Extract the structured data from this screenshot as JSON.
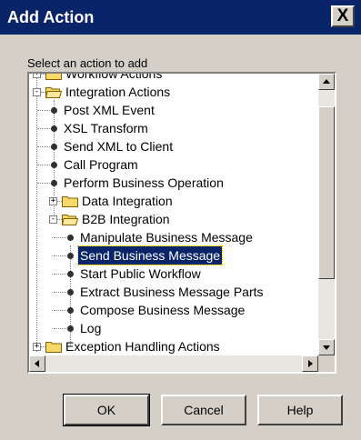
{
  "window": {
    "title": "Add Action",
    "close_label": "X"
  },
  "prompt": "Select an action to add",
  "tree": [
    {
      "label": "Workflow Actions",
      "kind": "folder",
      "expander": "+"
    },
    {
      "label": "Integration Actions",
      "kind": "folder-open",
      "expander": "-"
    },
    {
      "label": "Post XML Event",
      "kind": "leaf"
    },
    {
      "label": "XSL Transform",
      "kind": "leaf"
    },
    {
      "label": "Send XML to Client",
      "kind": "leaf"
    },
    {
      "label": "Call Program",
      "kind": "leaf"
    },
    {
      "label": "Perform Business Operation",
      "kind": "leaf"
    },
    {
      "label": "Data Integration",
      "kind": "folder",
      "expander": "+"
    },
    {
      "label": "B2B Integration",
      "kind": "folder-open",
      "expander": "-"
    },
    {
      "label": "Manipulate Business Message",
      "kind": "leaf"
    },
    {
      "label": "Send Business Message",
      "kind": "leaf",
      "selected": true
    },
    {
      "label": "Start Public Workflow",
      "kind": "leaf"
    },
    {
      "label": "Extract Business Message Parts",
      "kind": "leaf"
    },
    {
      "label": "Compose Business Message",
      "kind": "leaf"
    },
    {
      "label": "Log",
      "kind": "leaf"
    },
    {
      "label": "Exception Handling Actions",
      "kind": "folder",
      "expander": "+"
    }
  ],
  "buttons": {
    "ok": "OK",
    "cancel": "Cancel",
    "help": "Help"
  },
  "colors": {
    "title_bar": "#0a246a",
    "selection": "#0a246a",
    "folder": "#f8d868",
    "dialog_bg": "#d4d0c8"
  }
}
